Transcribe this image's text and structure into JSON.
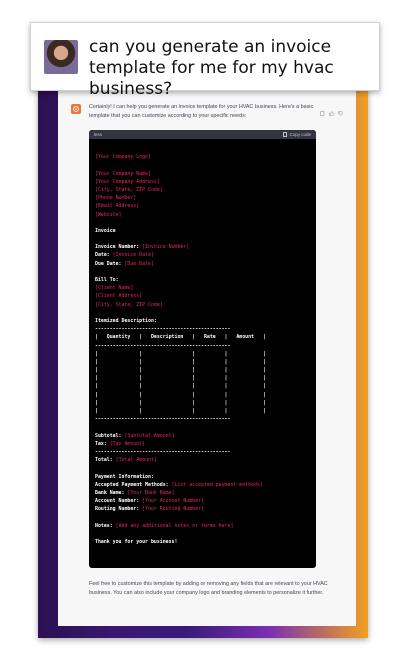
{
  "question": {
    "text": "can you generate an invoice template for me for my hvac business?"
  },
  "reply": {
    "intro": "Certainly! I can help you generate an invoice template for your HVAC business. Here's a basic template that you can customize according to your specific needs:",
    "outro": "Feel free to customize this template by adding or removing any fields that are relevant to your HVAC business. You can also include your company logo and branding elements to personalize it further."
  },
  "code_block": {
    "language": "less",
    "copy_label": "Copy code",
    "lines": [
      {
        "text": "",
        "kind": "blank"
      },
      {
        "text": "[Your Company Logo]",
        "kind": "ph"
      },
      {
        "text": "",
        "kind": "blank"
      },
      {
        "text": "[Your Company Name]",
        "kind": "ph"
      },
      {
        "text": "[Your Company Address]",
        "kind": "ph"
      },
      {
        "text": "[City, State, ZIP Code]",
        "kind": "ph"
      },
      {
        "text": "[Phone Number]",
        "kind": "ph"
      },
      {
        "text": "[Email Address]",
        "kind": "ph"
      },
      {
        "text": "[Website]",
        "kind": "ph"
      },
      {
        "text": "",
        "kind": "blank"
      },
      {
        "text": "Invoice",
        "kind": "w"
      },
      {
        "text": "",
        "kind": "blank"
      },
      {
        "label": "Invoice Number: ",
        "ph": "[Invoice Number]",
        "kind": "mixed"
      },
      {
        "label": "Date: ",
        "ph": "[Invoice Date]",
        "kind": "mixed"
      },
      {
        "label": "Due Date: ",
        "ph": "[Due Date]",
        "kind": "mixed"
      },
      {
        "text": "",
        "kind": "blank"
      },
      {
        "text": "Bill To:",
        "kind": "w"
      },
      {
        "text": "[Client Name]",
        "kind": "ph"
      },
      {
        "text": "[Client Address]",
        "kind": "ph"
      },
      {
        "text": "[City, State, ZIP Code]",
        "kind": "ph"
      },
      {
        "text": "",
        "kind": "blank"
      },
      {
        "text": "Itemized Description:",
        "kind": "w"
      },
      {
        "text": "----------------------------------------------",
        "kind": "w"
      },
      {
        "text": "|   Quantity   |   Description   |   Rate   |   Amount   |",
        "kind": "w"
      },
      {
        "text": "----------------------------------------------",
        "kind": "w"
      },
      {
        "text": "|              |                 |          |            |",
        "kind": "w"
      },
      {
        "text": "|              |                 |          |            |",
        "kind": "w"
      },
      {
        "text": "|              |                 |          |            |",
        "kind": "w"
      },
      {
        "text": "|              |                 |          |            |",
        "kind": "w"
      },
      {
        "text": "|              |                 |          |            |",
        "kind": "w"
      },
      {
        "text": "|              |                 |          |            |",
        "kind": "w"
      },
      {
        "text": "|              |                 |          |            |",
        "kind": "w"
      },
      {
        "text": "|              |                 |          |            |",
        "kind": "w"
      },
      {
        "text": "----------------------------------------------",
        "kind": "w"
      },
      {
        "text": "",
        "kind": "blank"
      },
      {
        "label": "Subtotal: ",
        "ph": "[Subtotal Amount]",
        "kind": "mixed"
      },
      {
        "label": "Tax: ",
        "ph": "[Tax Amount]",
        "kind": "mixed"
      },
      {
        "text": "----------------------------------------------",
        "kind": "w"
      },
      {
        "label": "Total: ",
        "ph": "[Total Amount]",
        "kind": "mixed"
      },
      {
        "text": "",
        "kind": "blank"
      },
      {
        "text": "Payment Information:",
        "kind": "w"
      },
      {
        "label": "Accepted Payment Methods: ",
        "ph": "[List accepted payment methods]",
        "kind": "mixed"
      },
      {
        "label": "Bank Name: ",
        "ph": "[Your Bank Name]",
        "kind": "mixed"
      },
      {
        "label": "Account Number: ",
        "ph": "[Your Account Number]",
        "kind": "mixed"
      },
      {
        "label": "Routing Number: ",
        "ph": "[Your Routing Number]",
        "kind": "mixed"
      },
      {
        "text": "",
        "kind": "blank"
      },
      {
        "label": "Notes: ",
        "ph": "[Add any additional notes or terms here]",
        "kind": "mixed"
      },
      {
        "text": "",
        "kind": "blank"
      },
      {
        "text": "Thank you for your business!",
        "kind": "w"
      }
    ]
  },
  "icons": {
    "bot_avatar": "openai-logo-icon",
    "copy": "clipboard-icon",
    "actions": [
      "copy-icon",
      "thumbs-up-icon",
      "thumbs-down-icon"
    ]
  },
  "colors": {
    "placeholder": "#e8256b",
    "bot_avatar_bg": "#e8793a",
    "code_bg": "#000000",
    "code_header_bg": "#343541"
  }
}
